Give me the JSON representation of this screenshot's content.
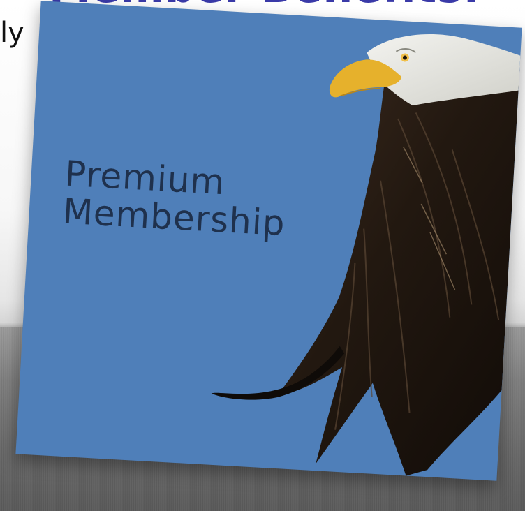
{
  "slide": {
    "title_fragment": "Member Benefits:",
    "body_fragment": "ly"
  },
  "card": {
    "line1": "Premium",
    "line2": "Membership"
  },
  "colors": {
    "card_blue": "#4f7fb9",
    "card_text": "#1c2b44",
    "title": "#3a3aa8",
    "footer": "#6e6e6e"
  }
}
